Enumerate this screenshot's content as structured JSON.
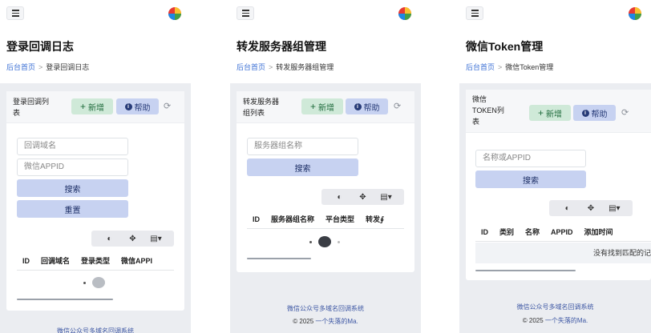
{
  "panels": [
    {
      "page_title": "登录回调日志",
      "breadcrumb": {
        "home": "后台首页",
        "current": "登录回调日志"
      },
      "card_title_line1": "登录回调列",
      "card_title_line2": "表",
      "add_label": "新增",
      "help_label": "帮助",
      "inputs": [
        "回调域名",
        "微信APPID"
      ],
      "search_label": "搜索",
      "reset_label": "重置",
      "columns": [
        "ID",
        "回调域名",
        "登录类型",
        "微信APPI"
      ],
      "footer_title": "微信公众号多域名回调系统"
    },
    {
      "page_title": "转发服务器组管理",
      "breadcrumb": {
        "home": "后台首页",
        "current": "转发服务器组管理"
      },
      "card_title_line1": "转发服务器",
      "card_title_line2": "组列表",
      "add_label": "新增",
      "help_label": "帮助",
      "inputs": [
        "服务器组名称"
      ],
      "search_label": "搜索",
      "columns": [
        "ID",
        "服务器组名称",
        "平台类型",
        "转发∮"
      ],
      "footer_title": "微信公众号多域名回调系统",
      "footer_copy": "© 2025",
      "footer_author": "一个失落的Ma."
    },
    {
      "page_title": "微信Token管理",
      "breadcrumb": {
        "home": "后台首页",
        "current": "微信Token管理"
      },
      "card_title_line1": "微信",
      "card_title_line2": "TOKEN列",
      "card_title_line3": "表",
      "add_label": "新增",
      "help_label": "帮助",
      "inputs": [
        "名称或APPID"
      ],
      "search_label": "搜索",
      "columns": [
        "ID",
        "类别",
        "名称",
        "APPID",
        "添加时间"
      ],
      "empty_text": "没有找到匹配的记",
      "footer_title": "微信公众号多域名回调系统",
      "footer_copy": "© 2025",
      "footer_author": "一个失落的Ma."
    }
  ],
  "icons": {
    "menu": "hamburger-icon",
    "logo": "four-color-logo",
    "refresh": "refresh-icon",
    "toggle": "toggle-icon",
    "fullscreen": "move-icon",
    "columns": "columns-icon"
  },
  "colors": {
    "add": "#cfe9d8",
    "help": "#c7d2f1",
    "link": "#3b6fd4",
    "logo": [
      "#e53935",
      "#fbc02d",
      "#1e88e5",
      "#43a047"
    ]
  }
}
